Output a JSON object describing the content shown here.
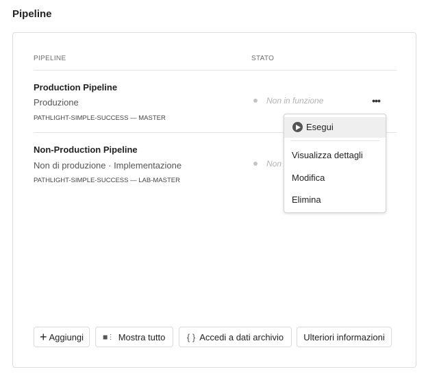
{
  "title": "Pipeline",
  "headers": {
    "pipeline": "PIPELINE",
    "status": "STATO"
  },
  "rows": [
    {
      "name": "Production Pipeline",
      "type": "Produzione",
      "repo": "PATHLIGHT-SIMPLE-SUCCESS — MASTER",
      "status": "Non in funzione"
    },
    {
      "name": "Non-Production Pipeline",
      "type": "Non di produzione · Implementazione",
      "repo": "PATHLIGHT-SIMPLE-SUCCESS — LAB-MASTER",
      "status": "Non in funzione"
    }
  ],
  "menu": {
    "run": "Esegui",
    "details": "Visualizza dettagli",
    "edit": "Modifica",
    "delete": "Elimina"
  },
  "buttons": {
    "add": "Aggiungi",
    "show_all": "Mostra tutto",
    "repo_access": "Accedi a dati archivio",
    "more_info": "Ulteriori informazioni"
  },
  "more_glyph": "•••"
}
